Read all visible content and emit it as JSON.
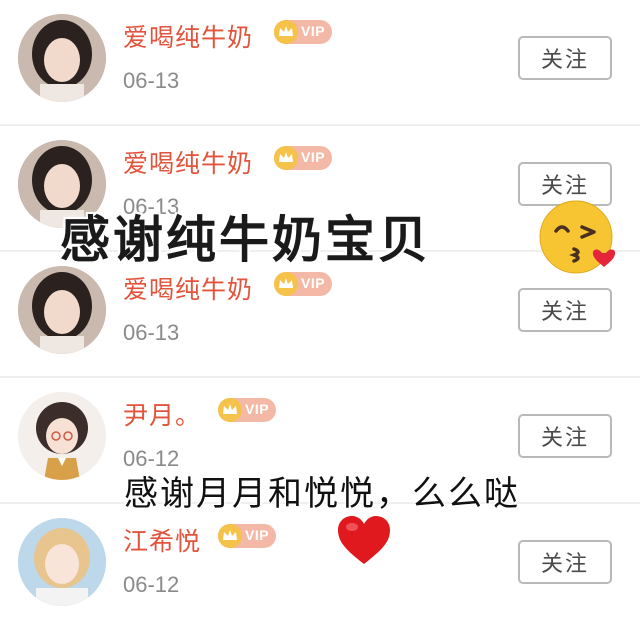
{
  "follow_list": [
    {
      "name": "爱喝纯牛奶",
      "badge": "VIP",
      "date": "06-13",
      "button": "关注",
      "avatar": "girl-avatar"
    },
    {
      "name": "爱喝纯牛奶",
      "badge": "VIP",
      "date": "06-13",
      "button": "关注",
      "avatar": "girl-avatar"
    },
    {
      "name": "爱喝纯牛奶",
      "badge": "VIP",
      "date": "06-13",
      "button": "关注",
      "avatar": "girl-avatar"
    },
    {
      "name": "尹月。",
      "badge": "VIP",
      "date": "06-12",
      "button": "关注",
      "avatar": "cartoon-girl-avatar"
    },
    {
      "name": "江希悦",
      "badge": "VIP",
      "date": "06-12",
      "button": "关注",
      "avatar": "blonde-girl-avatar"
    }
  ],
  "overlay": {
    "line1": "感谢纯牛奶宝贝",
    "line2": "感谢月月和悦悦，么么哒"
  },
  "colors": {
    "name": "#e2543b",
    "vip_bg": "#f3b8a6",
    "crown": "#f6c34a",
    "date": "#8a8a8a",
    "heart": "#e0191e"
  },
  "icons": [
    "crown-icon",
    "kiss-emoji",
    "heart-emoji"
  ]
}
